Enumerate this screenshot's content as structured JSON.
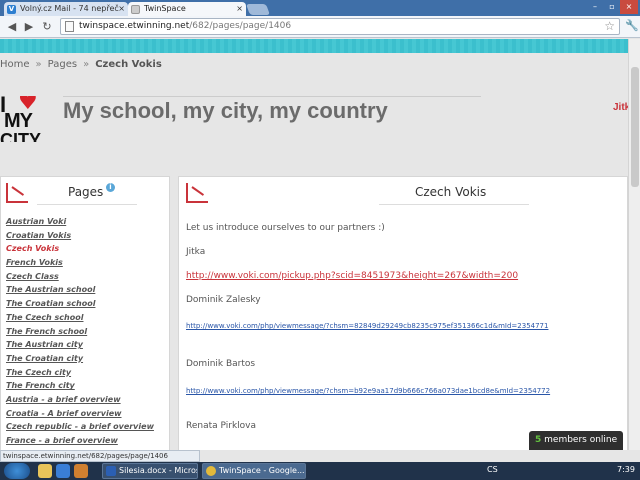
{
  "browser": {
    "tabs": [
      {
        "label": "Volný.cz Mail - 74 nepřeč",
        "favicon": "V"
      },
      {
        "label": "TwinSpace",
        "favicon": ""
      }
    ],
    "url_host": "twinspace.etwinning.net",
    "url_path": "/682/pages/page/1406"
  },
  "breadcrumb": {
    "home": "Home",
    "sep": "»",
    "pages": "Pages",
    "current": "Czech Vokis"
  },
  "logo": {
    "i": "I",
    "my": "MY",
    "city": "CITY"
  },
  "header": {
    "title": "My school, my city, my country",
    "user": "Jitk"
  },
  "sidebar": {
    "title": "Pages",
    "items": [
      "Austrian Voki",
      "Croatian Vokis",
      "Czech Vokis",
      "French Vokis",
      "Czech Class",
      "The Austrian school",
      "The Croatian school",
      "The Czech school",
      "The French school",
      "The Austrian city",
      "The Croatian city",
      "The Czech city",
      "The French city",
      "Austria - a brief overview",
      "Croatia - A brief overview",
      "Czech republic - a brief overview",
      "France - a brief overview"
    ]
  },
  "main": {
    "title": "Czech Vokis",
    "intro": "Let us introduce ourselves to our partners :)",
    "entries": [
      {
        "name": "Jitka",
        "link": "http://www.voki.com/pickup.php?scid=8451973&height=267&width=200"
      },
      {
        "name": "Dominik Zalesky",
        "link": "http://www.voki.com/php/viewmessage/?chsm=82849d29249cb8235c975ef351366c1d&mId=2354771"
      },
      {
        "name": "Dominik Bartos",
        "link": "http://www.voki.com/php/viewmessage/?chsm=b92e9aa17d9b666c766a073dae1bcd8e&mId=2354772"
      },
      {
        "name": "Renata Pirklova",
        "link": ""
      }
    ]
  },
  "members_online": {
    "count": "5",
    "label": "members online"
  },
  "status_url": "twinspace.etwinning.net/682/pages/page/1406",
  "taskbar": {
    "tasks": [
      "Silesia.docx - Micros...",
      "TwinSpace - Google..."
    ],
    "lang": "CS",
    "clock": "7:39"
  }
}
